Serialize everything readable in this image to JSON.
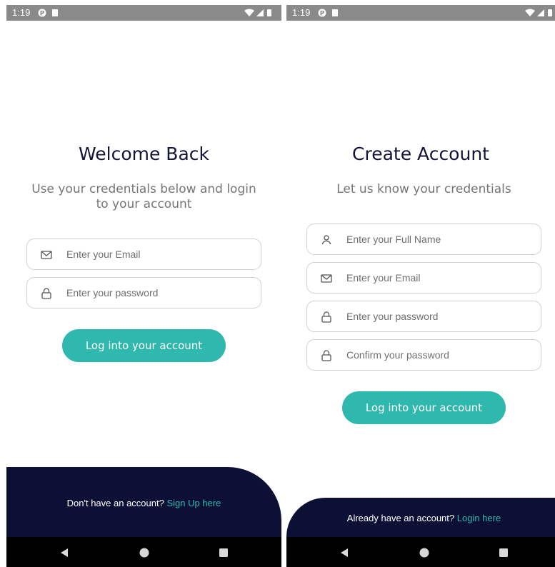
{
  "screens": [
    {
      "status_time": "1:19",
      "title": "Welcome Back",
      "subtitle": "Use your credentials below and login to your account",
      "fields": [
        {
          "icon": "mail-icon",
          "placeholder": "Enter your Email"
        },
        {
          "icon": "lock-icon",
          "placeholder": "Enter your password"
        }
      ],
      "primary_button": "Log into your account",
      "footer_prompt": "Don't have an account?",
      "footer_link": "Sign Up here"
    },
    {
      "status_time": "1:19",
      "title": "Create Account",
      "subtitle": "Let us know your credentials",
      "fields": [
        {
          "icon": "person-icon",
          "placeholder": "Enter your Full Name"
        },
        {
          "icon": "mail-icon",
          "placeholder": "Enter your Email"
        },
        {
          "icon": "lock-icon",
          "placeholder": "Enter your password"
        },
        {
          "icon": "lock-icon",
          "placeholder": "Confirm your password"
        }
      ],
      "primary_button": "Log into your account",
      "footer_prompt": "Already have an account?",
      "footer_link": "Login here"
    }
  ],
  "colors": {
    "accent": "#2fb8ad",
    "title": "#12143a",
    "footer_bg": "#0d1035",
    "status_bar": "#8a8a8a",
    "nav_bar": "#000000"
  },
  "nav_icons": [
    "back-icon",
    "home-icon",
    "recents-icon"
  ]
}
